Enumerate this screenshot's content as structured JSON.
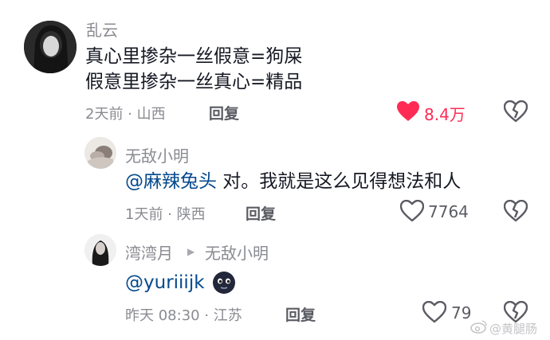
{
  "comments": [
    {
      "username": "乱云",
      "lines": [
        "真心里掺杂一丝假意=狗屎",
        "假意里掺杂一丝真心=精品"
      ],
      "time_location": "2天前 · 山西",
      "reply_label": "回复",
      "likes": "8.4万",
      "liked": true
    },
    {
      "username": "无敌小明",
      "mention": "@麻辣兔头",
      "text": " 对。我就是这么见得想法和人",
      "time_location": "1天前 · 陕西",
      "reply_label": "回复",
      "likes": "7764",
      "liked": false
    },
    {
      "username": "湾湾月",
      "reply_to": "无敌小明",
      "mention": "@yuriiijk",
      "time_location": "昨天 08:30 · 江苏",
      "reply_label": "回复",
      "likes": "79",
      "liked": false
    }
  ],
  "watermark": "@黄腿肠",
  "colors": {
    "like_active": "#fe2c55",
    "mention": "#04498d",
    "meta": "#8a8b91"
  },
  "icons": [
    "heart-icon",
    "broken-heart-icon",
    "play-arrow-icon",
    "emoji-sticker-icon",
    "weibo-logo-icon"
  ]
}
